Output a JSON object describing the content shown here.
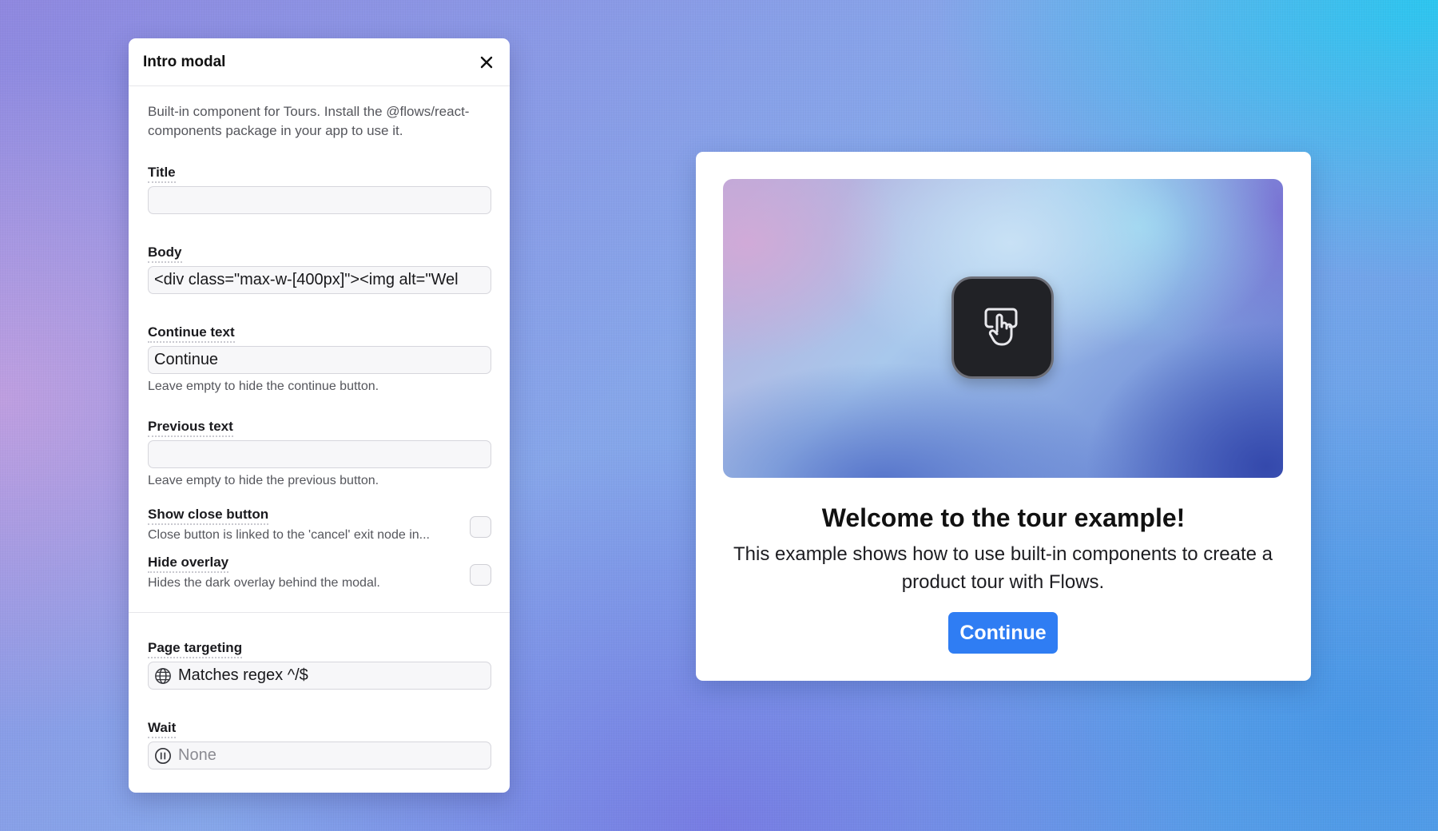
{
  "panel": {
    "title": "Intro modal",
    "description": "Built-in component for Tours. Install the @flows/react-components package in your app to use it.",
    "fields": {
      "title": {
        "label": "Title",
        "value": ""
      },
      "body": {
        "label": "Body",
        "value": "<div class=\"max-w-[400px]\"><img alt=\"Wel"
      },
      "continue_text": {
        "label": "Continue text",
        "value": "Continue",
        "hint": "Leave empty to hide the continue button."
      },
      "previous_text": {
        "label": "Previous text",
        "value": "",
        "hint": "Leave empty to hide the previous button."
      },
      "show_close_button": {
        "label": "Show close button",
        "hint": "Close button is linked to the 'cancel' exit node in...",
        "checked": false
      },
      "hide_overlay": {
        "label": "Hide overlay",
        "hint": "Hides the dark overlay behind the modal.",
        "checked": false
      },
      "page_targeting": {
        "label": "Page targeting",
        "value": "Matches regex ^/$",
        "icon": "globe-icon"
      },
      "wait": {
        "label": "Wait",
        "placeholder": "None",
        "icon": "pause-circle-icon"
      }
    }
  },
  "preview": {
    "title": "Welcome to the tour example!",
    "body": "This example shows how to use built-in components to create a product tour with Flows.",
    "continue_label": "Continue",
    "icon": "pointer-hand-icon",
    "accent_color": "#2f7df3"
  }
}
